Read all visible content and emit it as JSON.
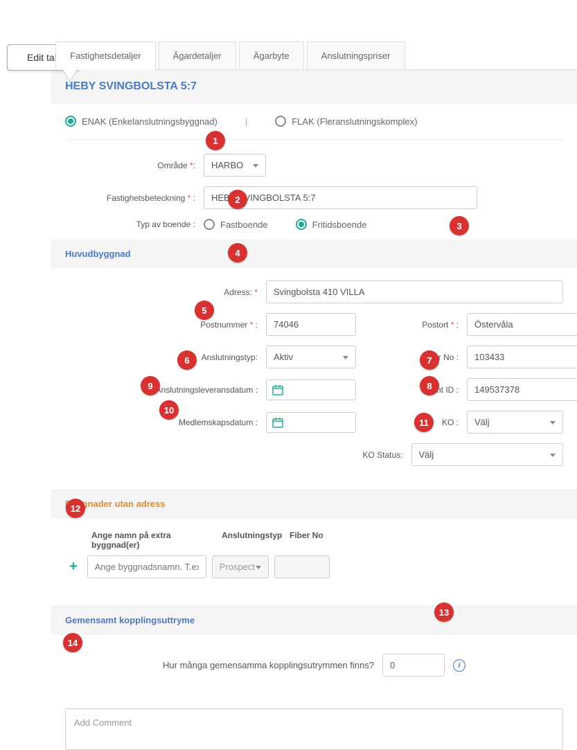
{
  "callout": {
    "text": "Edit tab"
  },
  "tabs": [
    {
      "label": "Fastighetsdetaljer",
      "active": true
    },
    {
      "label": "Ägardetaljer"
    },
    {
      "label": "Ägarbyte"
    },
    {
      "label": "Anslutningspriser"
    }
  ],
  "page_title": "HEBY SVINGBOLSTA 5:7",
  "connection_type": {
    "enak": {
      "label": "ENAK (Enkelanslutningsbyggnad)",
      "selected": true
    },
    "separator": "|",
    "flak": {
      "label": "FLAK (Fleranslutningskomplex)",
      "selected": false
    }
  },
  "omrade": {
    "label": "Område",
    "value": "HARBO"
  },
  "fastighetsbeteckning": {
    "label": "Fastighetsbeteckning",
    "value": "HEBY SVINGBOLSTA 5:7"
  },
  "typ_av_boende": {
    "label": "Typ av boende :",
    "fastboende": {
      "label": "Fastboende",
      "selected": false
    },
    "fritidsboende": {
      "label": "Fritidsboende",
      "selected": true
    }
  },
  "huvudbyggnad": {
    "header": "Huvudbyggnad",
    "adress": {
      "label": "Adress:",
      "value": "Svingbolsta 410 VILLA"
    },
    "postnummer": {
      "label": "Postnummer",
      "value": "74046"
    },
    "postort": {
      "label": "Postort",
      "value": "Östervåla"
    },
    "anslutningstyp": {
      "label": "Anslutningstyp:",
      "value": "Aktiv"
    },
    "fiber_no": {
      "label": "Fiber No :",
      "value": "103433"
    },
    "anslutningsleveransdatum": {
      "label": "Anslutningsleveransdatum :",
      "value": ""
    },
    "point_id": {
      "label": "Point ID :",
      "value": "149537378"
    },
    "medlemskapsdatum": {
      "label": "Medlemskapsdatum :",
      "value": ""
    },
    "ko": {
      "label": "KO :",
      "value": "Välj"
    },
    "ko_status": {
      "label": "KO Status:",
      "value": "Välj"
    }
  },
  "byggnader_utan_adress": {
    "header": "Byggnader utan adress",
    "col1": "Ange namn på extra byggnad(er)",
    "col2": "Anslutningstyp",
    "col3": "Fiber No",
    "placeholder": "Ange byggnadsnamn. T.ex.Byg",
    "select_value": "Prospect"
  },
  "gemensamt": {
    "header": "Gemensamt kopplingsuttryme",
    "question": "Hur många gemensamma kopplingsutrymmen finns?",
    "value": "0"
  },
  "comment": {
    "placeholder": "Add Comment"
  },
  "badges": [
    "1",
    "2",
    "3",
    "4",
    "5",
    "6",
    "7",
    "8",
    "9",
    "10",
    "11",
    "12",
    "13",
    "14"
  ]
}
